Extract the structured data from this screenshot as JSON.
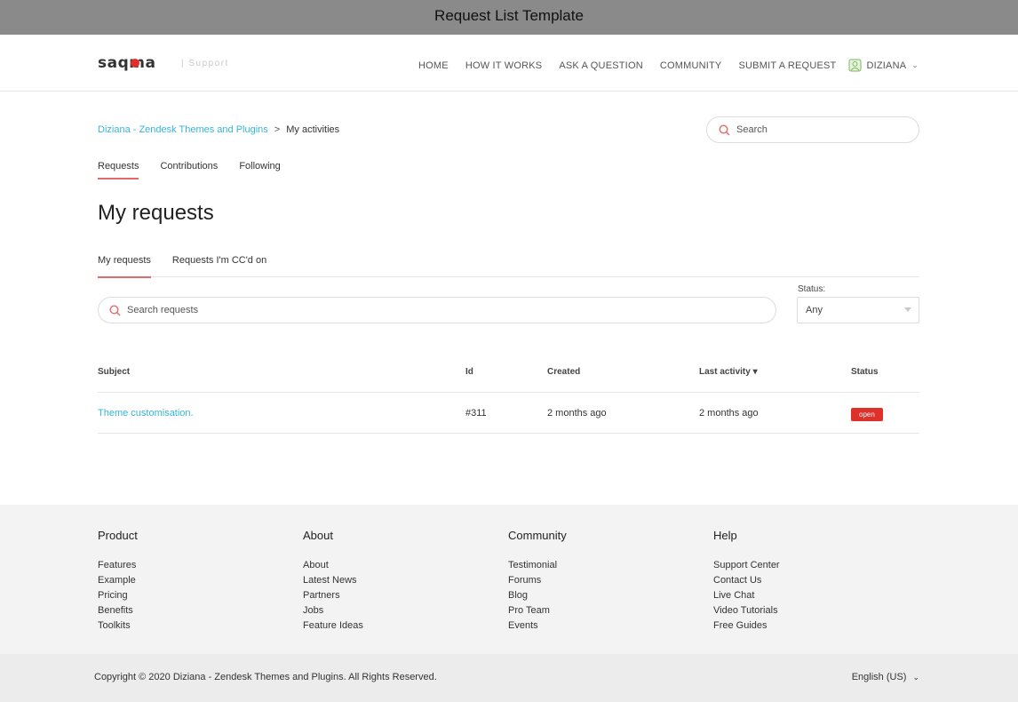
{
  "window": {
    "title": "Request List Template"
  },
  "brand": {
    "logo_text": "saqma",
    "tagline": "| Support",
    "accent": "#e46a6a",
    "link_color": "#36b5d8"
  },
  "nav": {
    "items": [
      "HOME",
      "HOW IT WORKS",
      "ASK A QUESTION",
      "COMMUNITY",
      "SUBMIT A REQUEST"
    ],
    "user": "DIZIANA"
  },
  "breadcrumb": {
    "root": "Diziana - Zendesk Themes and Plugins",
    "separator": ">",
    "current": "My activities"
  },
  "search": {
    "placeholder": "Search"
  },
  "activity_tabs": [
    "Requests",
    "Contributions",
    "Following"
  ],
  "page_title": "My requests",
  "request_tabs": [
    "My requests",
    "Requests I'm CC'd on"
  ],
  "request_search": {
    "placeholder": "Search requests"
  },
  "status_filter": {
    "label": "Status:",
    "selected": "Any"
  },
  "table": {
    "headers": [
      "Subject",
      "Id",
      "Created",
      "Last activity ▾",
      "Status"
    ],
    "rows": [
      {
        "subject": "Theme customisation.",
        "id": "#311",
        "created": "2 months ago",
        "last_activity": "2 months ago",
        "status": "open",
        "status_color": "#e0302b"
      }
    ]
  },
  "footer": {
    "columns": [
      {
        "heading": "Product",
        "links": [
          "Features",
          "Example",
          "Pricing",
          "Benefits",
          "Toolkits"
        ]
      },
      {
        "heading": "About",
        "links": [
          "About",
          "Latest News",
          "Partners",
          "Jobs",
          "Feature Ideas"
        ]
      },
      {
        "heading": "Community",
        "links": [
          "Testimonial",
          "Forums",
          "Blog",
          "Pro Team",
          "Events"
        ]
      },
      {
        "heading": "Help",
        "links": [
          "Support Center",
          "Contact Us",
          "Live Chat",
          "Video Tutorials",
          "Free Guides"
        ]
      }
    ],
    "copyright": "Copyright © 2020 Diziana - Zendesk Themes and Plugins. All Rights Reserved.",
    "language": "English (US)"
  }
}
